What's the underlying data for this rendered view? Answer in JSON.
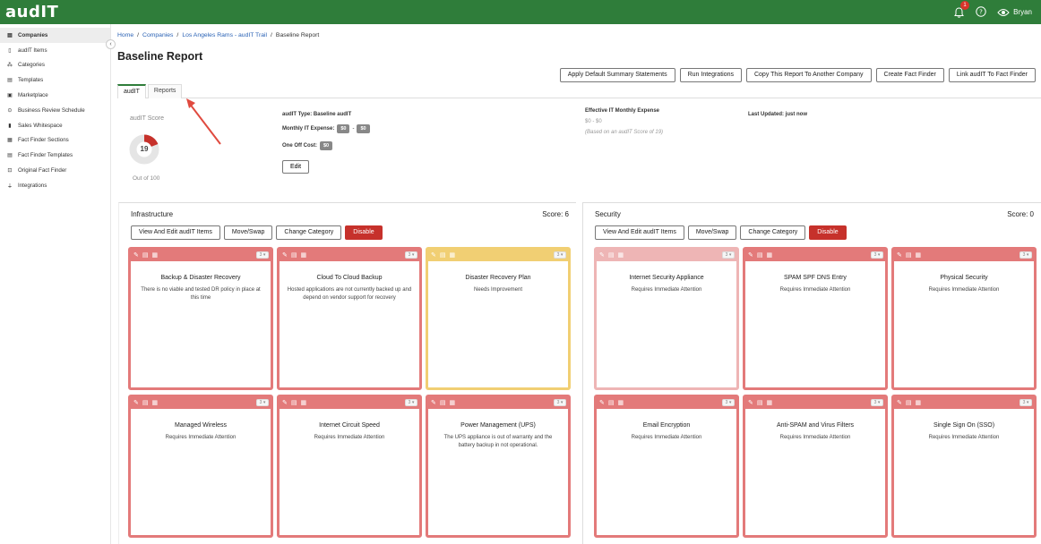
{
  "app": {
    "logo": "audIT",
    "notif_count": "1",
    "user": "Bryan"
  },
  "sidebar": {
    "items": [
      {
        "label": "Companies",
        "icon": "building-icon",
        "glyph": "▤",
        "active": true
      },
      {
        "label": "audIT Items",
        "icon": "file-icon",
        "glyph": "▯"
      },
      {
        "label": "Categories",
        "icon": "shapes-icon",
        "glyph": "⁂"
      },
      {
        "label": "Templates",
        "icon": "document-icon",
        "glyph": "▤"
      },
      {
        "label": "Marketplace",
        "icon": "store-icon",
        "glyph": "▣"
      },
      {
        "label": "Business Review Schedule",
        "icon": "car-icon",
        "glyph": "⊙"
      },
      {
        "label": "Sales Whitespace",
        "icon": "bar-chart-icon",
        "glyph": "▮"
      },
      {
        "label": "Fact Finder Sections",
        "icon": "table-icon",
        "glyph": "▦"
      },
      {
        "label": "Fact Finder Templates",
        "icon": "template-icon",
        "glyph": "▤"
      },
      {
        "label": "Original Fact Finder",
        "icon": "folder-icon",
        "glyph": "⊡"
      },
      {
        "label": "Integrations",
        "icon": "plug-icon",
        "glyph": "⏚"
      }
    ]
  },
  "breadcrumb": {
    "home": "Home",
    "companies": "Companies",
    "company": "Los Angeles Rams - audIT Trail",
    "current": "Baseline Report"
  },
  "page": {
    "title": "Baseline Report"
  },
  "actions": {
    "apply": "Apply Default Summary Statements",
    "run": "Run Integrations",
    "copy": "Copy This Report To Another Company",
    "create": "Create Fact Finder",
    "link": "Link audIT To Fact Finder"
  },
  "tabs": {
    "audit": "audIT",
    "reports": "Reports"
  },
  "score": {
    "label": "audIT Score",
    "value": "19",
    "fraction": 0.19,
    "out_of": "Out of 100"
  },
  "details": {
    "type_label": "audIT Type:",
    "type_value": "Baseline audIT",
    "monthly_label": "Monthly IT Expense:",
    "monthly_low": "$0",
    "monthly_sep": "-",
    "monthly_high": "$0",
    "oneoff_label": "One Off Cost:",
    "oneoff_value": "$0",
    "edit": "Edit",
    "eff_label": "Effective IT Monthly Expense",
    "eff_value": "$0 - $0",
    "eff_note": "(Based on an audIT Score of 19)",
    "updated": "Last Updated: just now"
  },
  "panels": {
    "left": {
      "title": "Infrastructure",
      "score": "Score: 6",
      "btn_view": "View And Edit audIT Items",
      "btn_move": "Move/Swap",
      "btn_change": "Change Category",
      "btn_disable": "Disable",
      "cards": [
        {
          "title": "Backup & Disaster Recovery",
          "desc": "There is no viable and tested DR policy in place at this time",
          "sel": "3 ▾"
        },
        {
          "title": "Cloud To Cloud Backup",
          "desc": "Hosted applications are not currently backed up and depend on vendor support for recovery",
          "sel": "3 ▾"
        },
        {
          "title": "Disaster Recovery Plan",
          "desc": "Needs Improvement",
          "sel": "3 ▾"
        },
        {
          "title": "Managed Wireless",
          "desc": "Requires Immediate Attention",
          "sel": "3 ▾"
        },
        {
          "title": "Internet Circuit Speed",
          "desc": "Requires Immediate Attention",
          "sel": "3 ▾"
        },
        {
          "title": "Power Management (UPS)",
          "desc": "The UPS appliance is out of warranty and the battery backup in not operational.",
          "sel": "3 ▾"
        }
      ]
    },
    "right": {
      "title": "Security",
      "score": "Score: 0",
      "btn_view": "View And Edit audIT Items",
      "btn_move": "Move/Swap",
      "btn_change": "Change Category",
      "btn_disable": "Disable",
      "cards": [
        {
          "title": "Internet Security Appliance",
          "desc": "Requires Immediate Attention",
          "sel": "3 ▾"
        },
        {
          "title": "SPAM SPF DNS Entry",
          "desc": "Requires Immediate Attention",
          "sel": "3 ▾"
        },
        {
          "title": "Physical Security",
          "desc": "Requires Immediate Attention",
          "sel": "3 ▾"
        },
        {
          "title": "Email Encryption",
          "desc": "Requires Immediate Attention",
          "sel": "3 ▾"
        },
        {
          "title": "Anti-SPAM and Virus Filters",
          "desc": "Requires Immediate Attention",
          "sel": "3 ▾"
        },
        {
          "title": "Single Sign On (SSO)",
          "desc": "Requires Immediate Attention",
          "sel": "3 ▾"
        }
      ]
    }
  },
  "colors": {
    "brand": "#2f7d3a",
    "danger": "#c6312b",
    "card_red": "#e37a7a",
    "card_yellow": "#f1cf73",
    "card_pink": "#eeb5b5"
  }
}
